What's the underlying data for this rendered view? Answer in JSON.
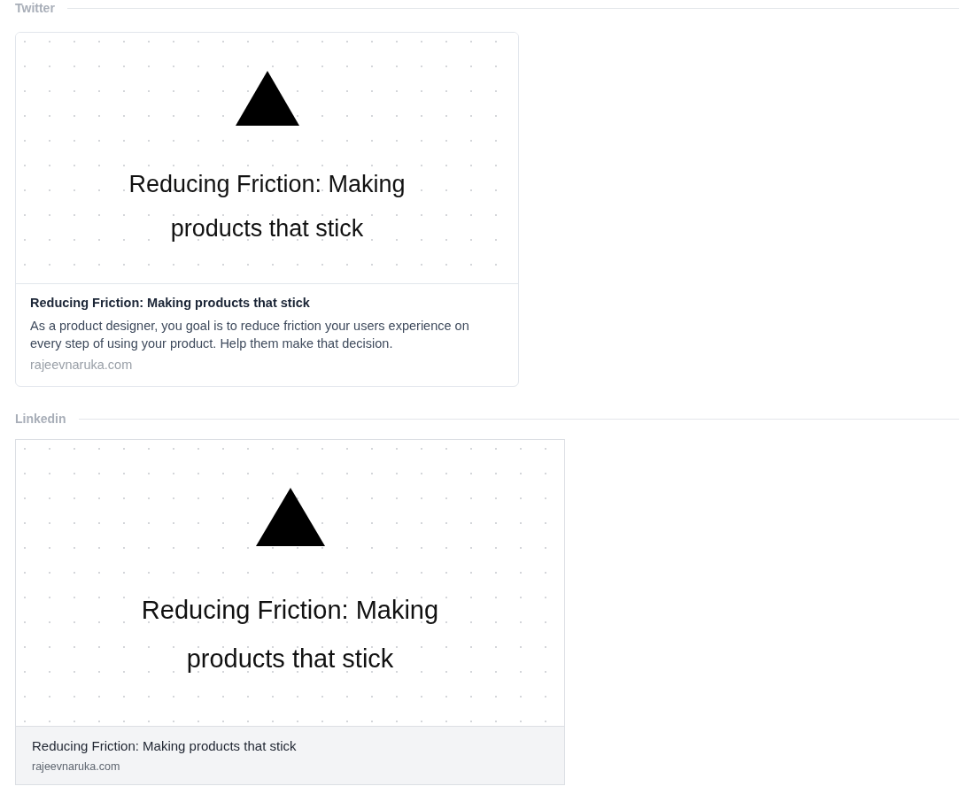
{
  "previews": [
    {
      "kind": "twitter",
      "heading": "Twitter",
      "image_title": "Reducing Friction: Making products that stick",
      "title": "Reducing Friction: Making products that stick",
      "description": "As a product designer, you goal is to reduce friction your users experience on every step of using your product. Help them make that decision.",
      "domain": "rajeevnaruka.com"
    },
    {
      "kind": "linkedin",
      "heading": "Linkedin",
      "image_title": "Reducing Friction: Making products that stick",
      "title": "Reducing Friction: Making products that stick",
      "domain": "rajeevnaruka.com"
    }
  ]
}
